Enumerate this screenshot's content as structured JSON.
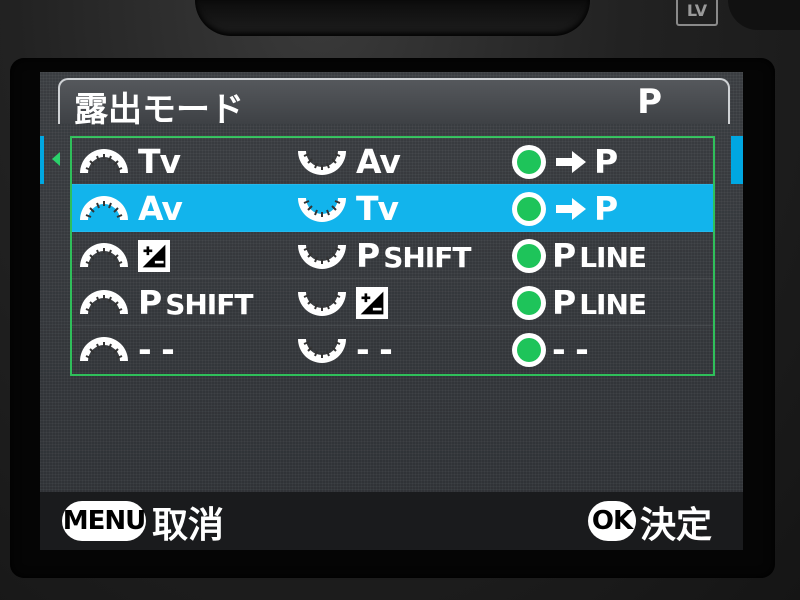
{
  "header": {
    "title": "露出モード",
    "mode": "P"
  },
  "camera": {
    "lv_label": "LV"
  },
  "rows": [
    {
      "front": "Tv",
      "rear": "Av",
      "green_arrow": true,
      "green": "P"
    },
    {
      "front": "Av",
      "rear": "Tv",
      "green_arrow": true,
      "green": "P",
      "selected": true
    },
    {
      "front": "EV_COMP",
      "rear_prefix": "P",
      "rear_suffix": "SHIFT",
      "green_prefix": "P",
      "green_suffix": "LINE"
    },
    {
      "front_prefix": "P",
      "front_suffix": "SHIFT",
      "rear": "EV_COMP",
      "green_prefix": "P",
      "green_suffix": "LINE"
    },
    {
      "front": "- -",
      "rear": "- -",
      "green": "- -"
    }
  ],
  "row_text": {
    "r0": {
      "front": "Tv",
      "rear": "Av",
      "green": "P"
    },
    "r1": {
      "front": "Av",
      "rear": "Tv",
      "green": "P"
    },
    "r2": {
      "rear_prefix": "P",
      "rear_suffix": "SHIFT",
      "green_prefix": "P",
      "green_suffix": "LINE"
    },
    "r3": {
      "front_prefix": "P",
      "front_suffix": "SHIFT",
      "green_prefix": "P",
      "green_suffix": "LINE"
    },
    "r4": {
      "front": "- -",
      "rear": "- -",
      "green": "- -"
    }
  },
  "footer": {
    "menu_button": "MENU",
    "cancel_label": "取消",
    "ok_button": "OK",
    "confirm_label": "決定"
  },
  "colors": {
    "selection": "#12b4ec",
    "frame": "#2fbf5a",
    "green_button": "#1ec45a"
  },
  "icons": [
    "front-dial-icon",
    "rear-dial-icon",
    "green-button-icon",
    "arrow-right-icon",
    "exposure-compensation-icon"
  ]
}
